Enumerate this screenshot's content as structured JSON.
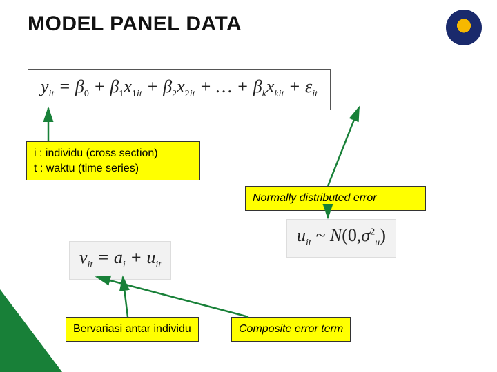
{
  "title": "MODEL PANEL DATA",
  "equation_main": {
    "y": "y",
    "it": "it",
    "eq": "=",
    "b": "β",
    "zero": "0",
    "one": "1",
    "two": "2",
    "k": "k",
    "x": "x",
    "dots": "…",
    "eps": "ε",
    "plus": "+"
  },
  "box_it_line1": "i : individu (cross section)",
  "box_it_line2": "t : waktu (time series)",
  "box_error": "Normally distributed error",
  "box_varies": "Bervariasi antar individu",
  "box_composite": "Composite error term",
  "eq_v": {
    "v": "v",
    "it": "it",
    "eq": "=",
    "a": "a",
    "i": "i",
    "plus": "+",
    "u": "u"
  },
  "eq_u": {
    "u": "u",
    "it": "it",
    "tilde": "~",
    "N": "N",
    "open": "(0,",
    "sigma": "σ",
    "two": "2",
    "sub_u": "u",
    "close": ")"
  }
}
